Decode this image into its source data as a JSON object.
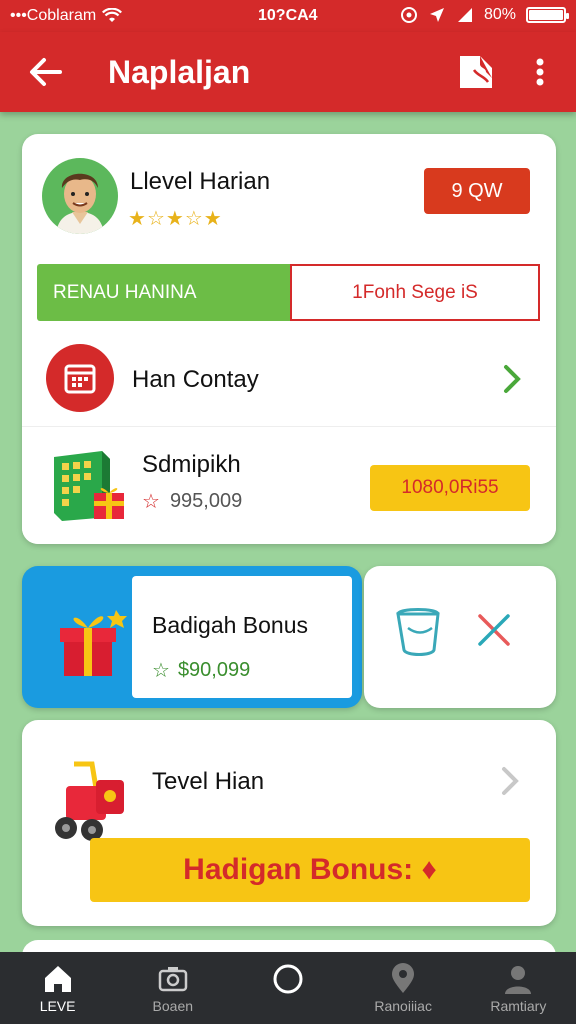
{
  "status_bar": {
    "carrier": "•••Coblaram",
    "time": "10?CA4",
    "battery": "80%"
  },
  "app_bar": {
    "title": "Naplaljan"
  },
  "level_card": {
    "title": "Llevel Harian",
    "rating_stars": 5,
    "badge_label": "9 QW",
    "tab_active_label": "RENAU HANINA",
    "tab_inactive_label": "1Fonh Sege iS",
    "calendar_row_label": "Han Contay",
    "reward_row": {
      "title": "Sdmipikh",
      "value": "995,009",
      "button_label": "1080,0Ri55"
    }
  },
  "bonus_card": {
    "title": "Badigah Bonus",
    "value": "$90,099"
  },
  "level_card_2": {
    "title": "Tevel Hian",
    "bonus_button_label": "Hadigan Bonus: ♦"
  },
  "bottom_nav": {
    "items": [
      {
        "label": "LEVE",
        "icon": "home-icon",
        "active": true
      },
      {
        "label": "Boaen",
        "icon": "camera-icon",
        "active": false
      },
      {
        "label": "",
        "icon": "circle-icon",
        "active": false
      },
      {
        "label": "Ranoiiiac",
        "icon": "location-pin-icon",
        "active": false
      },
      {
        "label": "Ramtiary",
        "icon": "person-icon",
        "active": false
      }
    ]
  },
  "colors": {
    "primary_red": "#d42a2a",
    "accent_green": "#6cbd46",
    "accent_yellow": "#f7c514",
    "accent_blue": "#1a9be0",
    "background": "#9bd39b"
  }
}
